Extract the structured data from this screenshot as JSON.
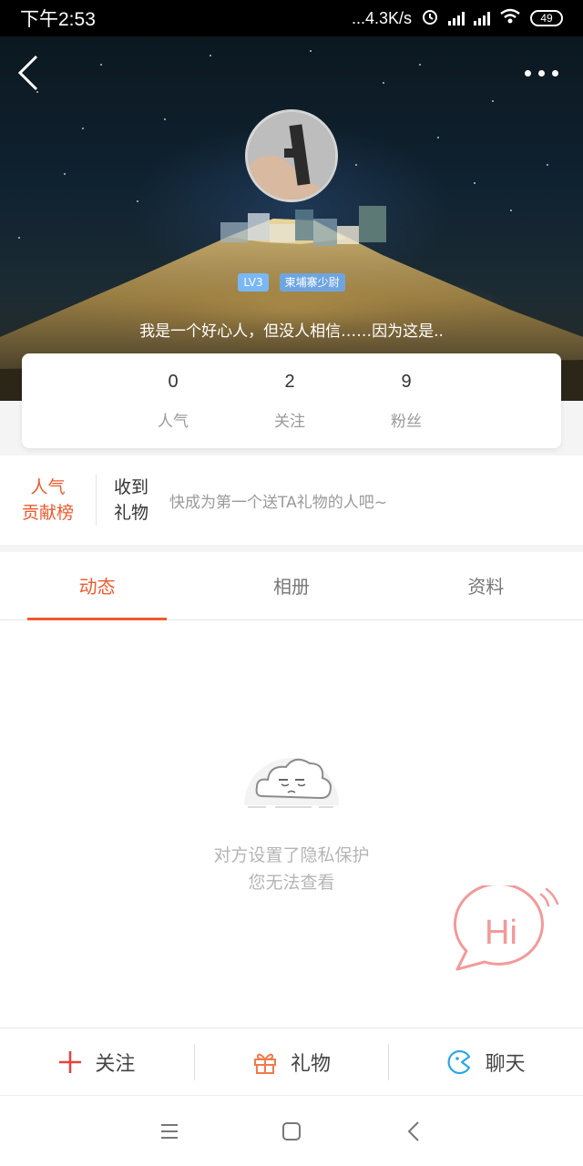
{
  "status_bar": {
    "time": "下午2:53",
    "net_speed": "...4.3K/s",
    "battery": "49"
  },
  "profile": {
    "level_badge": "LV3",
    "title_badge": "柬埔寨少尉",
    "signature": "我是一个好心人，但没人相信……因为这是.."
  },
  "stats": [
    {
      "value": "0",
      "label": "人气"
    },
    {
      "value": "2",
      "label": "关注"
    },
    {
      "value": "9",
      "label": "粉丝"
    }
  ],
  "gift_row": {
    "rank_line1": "人气",
    "rank_line2": "贡献榜",
    "received_line1": "收到",
    "received_line2": "礼物",
    "message": "快成为第一个送TA礼物的人吧~"
  },
  "tabs": [
    {
      "label": "动态",
      "active": true
    },
    {
      "label": "相册",
      "active": false
    },
    {
      "label": "资料",
      "active": false
    }
  ],
  "empty_state": {
    "line1": "对方设置了隐私保护",
    "line2": "您无法查看"
  },
  "hi_bubble": {
    "text": "Hi"
  },
  "actions": {
    "follow": "关注",
    "gift": "礼物",
    "chat": "聊天"
  },
  "colors": {
    "accent": "#ee5a2c",
    "muted": "#9a9a9a",
    "badge_blue": "#7ab7f5",
    "hi_pink": "#f29a9a",
    "chat_blue": "#2aa7e8"
  },
  "icons": [
    "back-icon",
    "more-icon",
    "plus-icon",
    "gift-icon",
    "chat-icon",
    "menu-icon",
    "home-icon",
    "nav-back-icon",
    "cloud-icon"
  ]
}
